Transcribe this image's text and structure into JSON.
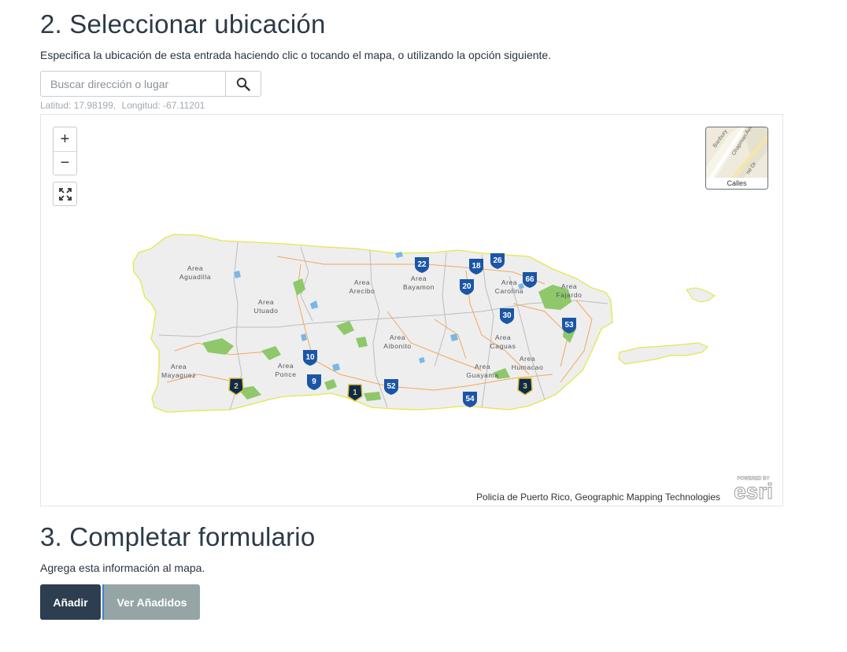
{
  "step2": {
    "title": "2. Seleccionar ubicación",
    "description": "Especifica la ubicación de esta entrada haciendo clic o tocando el mapa, o utilizando la opción siguiente."
  },
  "search": {
    "placeholder": "Buscar dirección o lugar",
    "icon": "search-icon"
  },
  "coordinates": {
    "lat": "Latitud: 17.98199,",
    "lon": "Longitud: -67.11201"
  },
  "map": {
    "zoom_in": "+",
    "zoom_out": "−",
    "fullscreen_icon": "expand-icon",
    "basemap_label": "Calles",
    "basemap_streets": [
      "Banbury",
      "Chapman Ave",
      "ne Dr"
    ],
    "attribution": "Policía de Puerto Rico, Geographic Mapping Technologies",
    "logo": {
      "top": "POWERED BY",
      "word": "esri"
    },
    "areas": [
      {
        "line1": "Area",
        "line2": "Aguadilla"
      },
      {
        "line1": "Area",
        "line2": "Arecibo"
      },
      {
        "line1": "Area",
        "line2": "Bayamon"
      },
      {
        "line1": "Area",
        "line2": "Carolina"
      },
      {
        "line1": "Area",
        "line2": "Fajardo"
      },
      {
        "line1": "Area",
        "line2": "Utuado"
      },
      {
        "line1": "Area",
        "line2": "Aibonito"
      },
      {
        "line1": "Area",
        "line2": "Caguas"
      },
      {
        "line1": "Area",
        "line2": "Humacao"
      },
      {
        "line1": "Area",
        "line2": "Mayaguez"
      },
      {
        "line1": "Area",
        "line2": "Ponce"
      },
      {
        "line1": "Area",
        "line2": "Guayama"
      }
    ],
    "highways": [
      "22",
      "18",
      "26",
      "66",
      "20",
      "30",
      "53",
      "10",
      "9",
      "2",
      "1",
      "52",
      "54",
      "3"
    ],
    "colors": {
      "land": "#eeeeee",
      "coast": "#e2e84a",
      "park": "#8ec86a",
      "water": "#7ab6e6",
      "road": "#f3a85a",
      "shield_blue": "#1b56a6",
      "shield_dark": "#0b2a55"
    }
  },
  "step3": {
    "title": "3. Completar formulario",
    "description": "Agrega esta información al mapa."
  },
  "buttons": {
    "add": "Añadir",
    "view_added": "Ver Añadidos"
  }
}
